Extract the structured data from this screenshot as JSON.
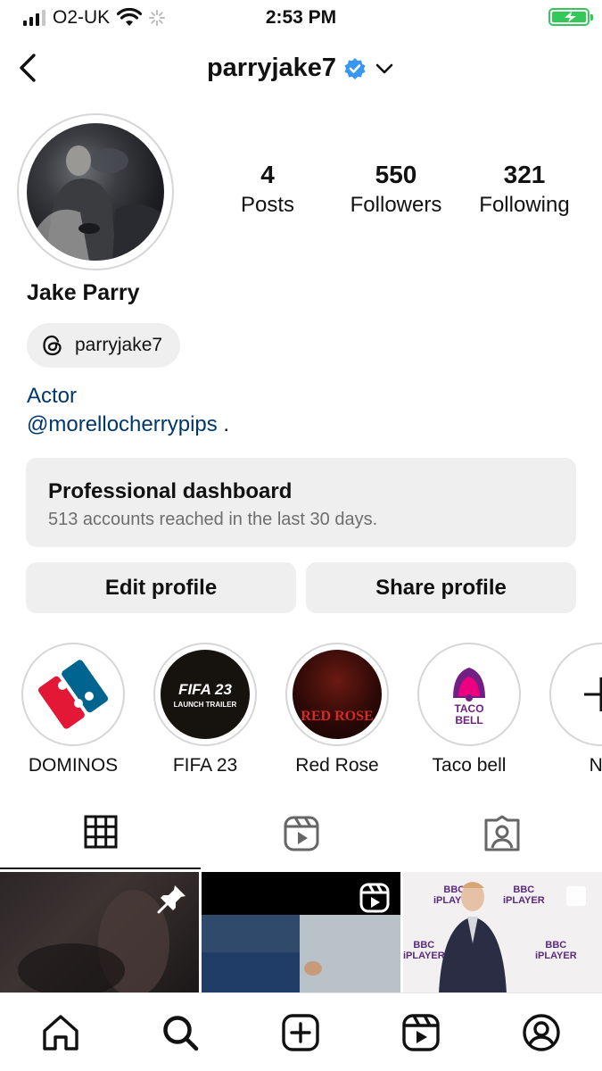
{
  "status_bar": {
    "carrier": "O2-UK",
    "time": "2:53 PM"
  },
  "header": {
    "username": "parryjake7"
  },
  "profile": {
    "stats": [
      {
        "value": "4",
        "label": "Posts"
      },
      {
        "value": "550",
        "label": "Followers"
      },
      {
        "value": "321",
        "label": "Following"
      }
    ],
    "full_name": "Jake Parry",
    "threads_handle": "parryjake7",
    "bio_line1": "Actor",
    "bio_mention": "@morellocherrypips",
    "bio_suffix": " ."
  },
  "dashboard": {
    "title": "Professional dashboard",
    "subtitle": "513 accounts reached in the last 30 days."
  },
  "actions": {
    "edit_label": "Edit profile",
    "share_label": "Share profile"
  },
  "highlights": [
    {
      "label": "DOMINOS"
    },
    {
      "label": "FIFA 23",
      "art_text_1": "FIFA 23",
      "art_text_2": "LAUNCH TRAILER"
    },
    {
      "label": "Red Rose",
      "art_text": "RED ROSE"
    },
    {
      "label": "Taco bell",
      "art_text_1": "TACO",
      "art_text_2": "BELL"
    },
    {
      "label": "Ne"
    }
  ],
  "grid_art_text": {
    "bbc_1": "BBC",
    "bbc_2": "iPLAYER"
  },
  "colors": {
    "link": "#00376b",
    "verified": "#3897f0",
    "battery": "#34c759",
    "chip_bg": "#efefef"
  }
}
